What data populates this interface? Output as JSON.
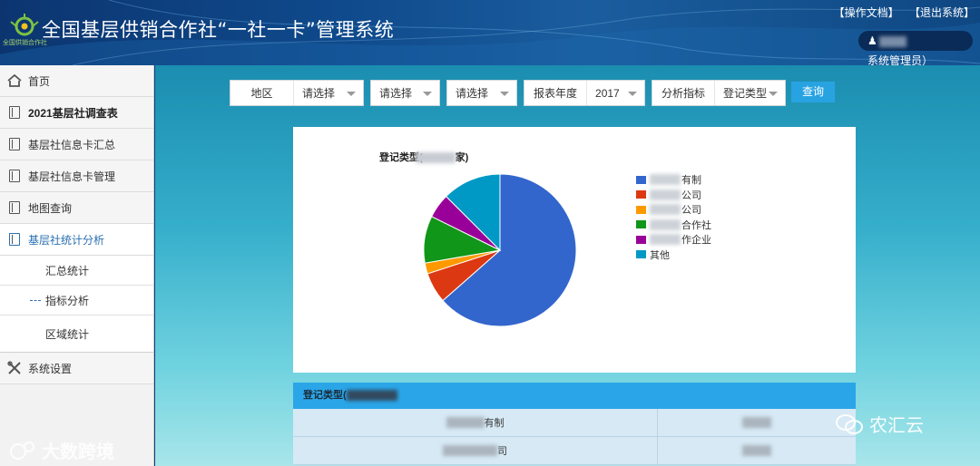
{
  "header": {
    "title": "全国基层供销合作社“一社一卡”管理系统",
    "logo_subtext": "全国供销合作社",
    "links": [
      "【操作文档】",
      "【退出系统】"
    ],
    "user_label": "系统管理员）"
  },
  "sidebar": {
    "items": [
      {
        "label": "首页",
        "icon": "home-icon"
      },
      {
        "label": "2021基层社调查表",
        "icon": "notebook-icon"
      },
      {
        "label": "基层社信息卡汇总",
        "icon": "notebook-icon"
      },
      {
        "label": "基层社信息卡管理",
        "icon": "notebook-icon"
      },
      {
        "label": "地图查询",
        "icon": "notebook-icon"
      },
      {
        "label": "基层社统计分析",
        "icon": "notebook-icon"
      }
    ],
    "sub_items": [
      "汇总统计",
      "指标分析",
      "区域统计"
    ],
    "settings": {
      "label": "系统设置",
      "icon": "tools-icon"
    }
  },
  "filters": {
    "region_label": "地区",
    "region_value_1": "请选择",
    "region_value_2": "请选择",
    "region_value_3": "请选择",
    "year_label": "报表年度",
    "year_value": "2017",
    "indicator_label": "分析指标",
    "indicator_value": "登记类型",
    "query_button": "查询"
  },
  "chart": {
    "title_prefix": "登记类型(",
    "title_suffix": "家)"
  },
  "chart_data": {
    "type": "pie",
    "title": "登记类型(家)",
    "legend": [
      "有制",
      "公司",
      "公司",
      "合作社",
      "作企业",
      "其他"
    ],
    "colors": [
      "#3366cc",
      "#dc3912",
      "#ff9900",
      "#109618",
      "#990099",
      "#0099c6"
    ],
    "values": [
      63.5,
      6.5,
      2.3,
      10.0,
      5.2,
      12.5
    ],
    "legend_position": "right"
  },
  "table": {
    "header_prefix": "登记类型(",
    "rows": [
      {
        "c1_suffix": "有制"
      },
      {
        "c1_suffix": "司"
      }
    ]
  },
  "watermarks": {
    "left": "大数跨境",
    "right": "农汇云"
  },
  "colors": {
    "accent": "#28a3e2",
    "header_bg": "#0f4a8c",
    "active_nav": "#2a6fb0"
  }
}
